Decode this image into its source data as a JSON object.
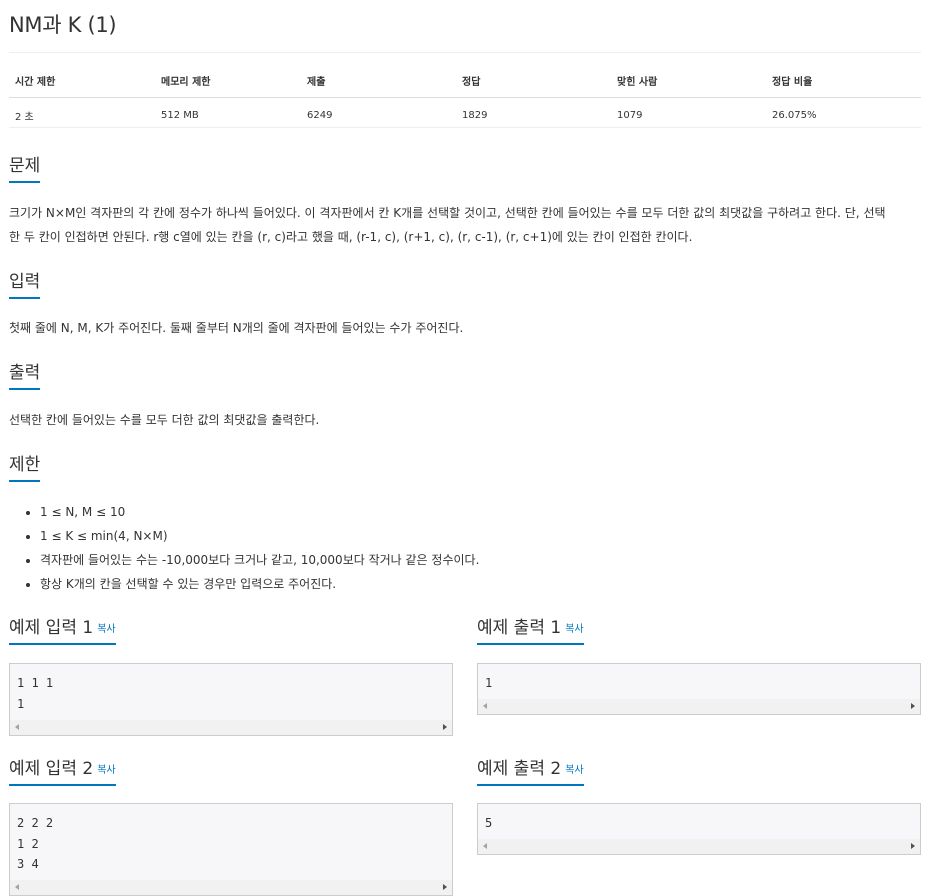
{
  "title": "NM과 K (1)",
  "info_table": {
    "headers": [
      "시간 제한",
      "메모리 제한",
      "제출",
      "정답",
      "맞힌 사람",
      "정답 비율"
    ],
    "values": [
      "2 초",
      "512 MB",
      "6249",
      "1829",
      "1079",
      "26.075%"
    ]
  },
  "sections": {
    "problem": {
      "heading": "문제",
      "line1": "크기가 N×M인 격자판의 각 칸에 정수가 하나씩 들어있다. 이 격자판에서 칸 K개를 선택할 것이고, 선택한 칸에 들어있는 수를 모두 더한 값의 최댓값을 구하려고 한다. 단, 선택",
      "line2": "한 두 칸이 인접하면 안된다. r행 c열에 있는 칸을 (r, c)라고 했을 때, (r-1, c), (r+1, c), (r, c-1), (r, c+1)에 있는 칸이 인접한 칸이다."
    },
    "input": {
      "heading": "입력",
      "text": "첫째 줄에 N, M, K가 주어진다. 둘째 줄부터 N개의 줄에 격자판에 들어있는 수가 주어진다."
    },
    "output": {
      "heading": "출력",
      "text": "선택한 칸에 들어있는 수를 모두 더한 값의 최댓값을 출력한다."
    },
    "limits": {
      "heading": "제한",
      "items": [
        "1 ≤ N, M ≤ 10",
        "1 ≤ K ≤ min(4, N×M)",
        "격자판에 들어있는 수는 -10,000보다 크거나 같고, 10,000보다 작거나 같은 정수이다.",
        "항상 K개의 칸을 선택할 수 있는 경우만 입력으로 주어진다."
      ]
    }
  },
  "examples": [
    {
      "input_heading": "예제 입력 1",
      "output_heading": "예제 출력 1",
      "copy_label": "복사",
      "input": "1 1 1\n1",
      "output": "1"
    },
    {
      "input_heading": "예제 입력 2",
      "output_heading": "예제 출력 2",
      "copy_label": "복사",
      "input": "2 2 2\n1 2\n3 4",
      "output": "5"
    }
  ],
  "colors": {
    "accent": "#0076c0",
    "text": "#333333",
    "pre_bg": "#f7f7f9"
  }
}
